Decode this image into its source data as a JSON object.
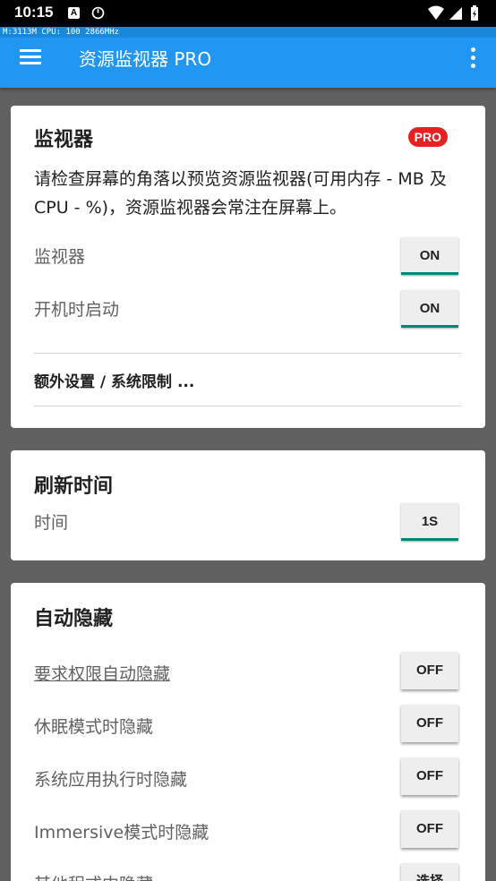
{
  "status_bar": {
    "time": "10:15",
    "notif_letter": "A"
  },
  "overlay": {
    "text": "M:3113M CPU: 100 2866MHz"
  },
  "appbar": {
    "title": "资源监视器 PRO"
  },
  "monitor_card": {
    "title": "监视器",
    "badge": "PRO",
    "description": "请检查屏幕的角落以预览资源监视器(可用内存 - MB 及 CPU - %)，资源监视器会常注在屏幕上。",
    "rows": [
      {
        "label": "监视器",
        "value": "ON"
      },
      {
        "label": "开机时启动",
        "value": "ON"
      }
    ],
    "extra_link": "额外设置 / 系统限制 ..."
  },
  "refresh_card": {
    "title": "刷新时间",
    "row": {
      "label": "时间",
      "value": "1S"
    }
  },
  "autohide_card": {
    "title": "自动隐藏",
    "rows": [
      {
        "label": "要求权限自动隐藏",
        "value": "OFF"
      },
      {
        "label": "休眠模式时隐藏",
        "value": "OFF"
      },
      {
        "label": "系统应用执行时隐藏",
        "value": "OFF"
      },
      {
        "label": "Immersive模式时隐藏",
        "value": "OFF"
      },
      {
        "label": "其他程式中隐藏",
        "value": "选择"
      }
    ]
  },
  "colors": {
    "appbar": "#2196f3",
    "accent": "#00897b",
    "badge": "#e52222",
    "background": "#616161"
  }
}
